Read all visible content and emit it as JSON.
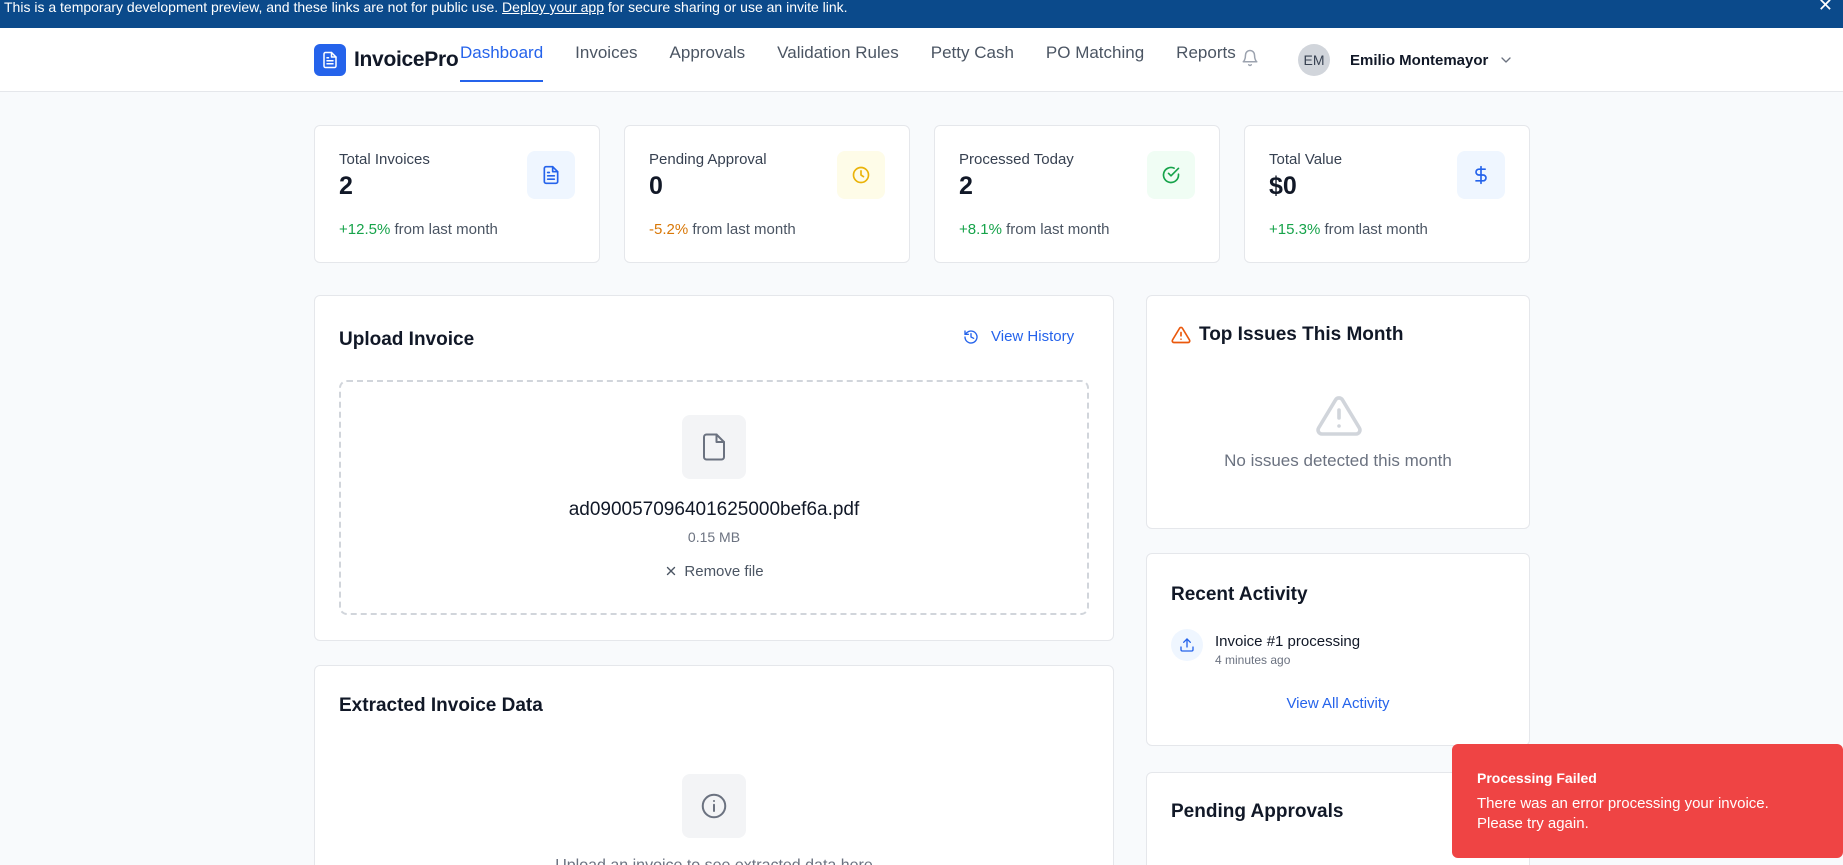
{
  "banner": {
    "text_before": "This is a temporary development preview, and these links are not for public use. ",
    "link": "Deploy your app",
    "text_after": " for secure sharing or use an invite link.",
    "close": "✕"
  },
  "header": {
    "app_name": "InvoicePro",
    "nav": [
      "Dashboard",
      "Invoices",
      "Approvals",
      "Validation Rules",
      "Petty Cash",
      "PO Matching",
      "Reports"
    ],
    "active_nav": "Dashboard",
    "user_initials": "EM",
    "user_name": "Emilio Montemayor"
  },
  "stats": [
    {
      "label": "Total Invoices",
      "value": "2",
      "change": "+12.5%",
      "suffix": " from last month",
      "icon": "document-icon"
    },
    {
      "label": "Pending Approval",
      "value": "0",
      "change": "-5.2%",
      "suffix": " from last month",
      "icon": "clock-icon"
    },
    {
      "label": "Processed Today",
      "value": "2",
      "change": "+8.1%",
      "suffix": " from last month",
      "icon": "check-circle-icon"
    },
    {
      "label": "Total Value",
      "value": "$0",
      "change": "+15.3%",
      "suffix": " from last month",
      "icon": "dollar-icon"
    }
  ],
  "upload": {
    "title": "Upload Invoice",
    "view_history": "View History",
    "file_name": "ad090057096401625000bef6a.pdf",
    "file_size": "0.15 MB",
    "remove": "Remove file"
  },
  "extracted": {
    "title": "Extracted Invoice Data",
    "empty_text": "Upload an invoice to see extracted data here"
  },
  "issues": {
    "title": "Top Issues This Month",
    "empty_text": "No issues detected this month"
  },
  "activity": {
    "title": "Recent Activity",
    "items": [
      {
        "title": "Invoice #1 processing",
        "time": "4 minutes ago"
      }
    ],
    "view_all": "View All Activity"
  },
  "pending": {
    "title": "Pending Approvals"
  },
  "toast": {
    "title": "Processing Failed",
    "message": "There was an error processing your invoice. Please try again."
  },
  "colors": {
    "brand": "#2563eb",
    "banner": "#0b4a8b",
    "positive": "#16a34a",
    "negative": "#d97706",
    "toast": "#ef4444"
  }
}
